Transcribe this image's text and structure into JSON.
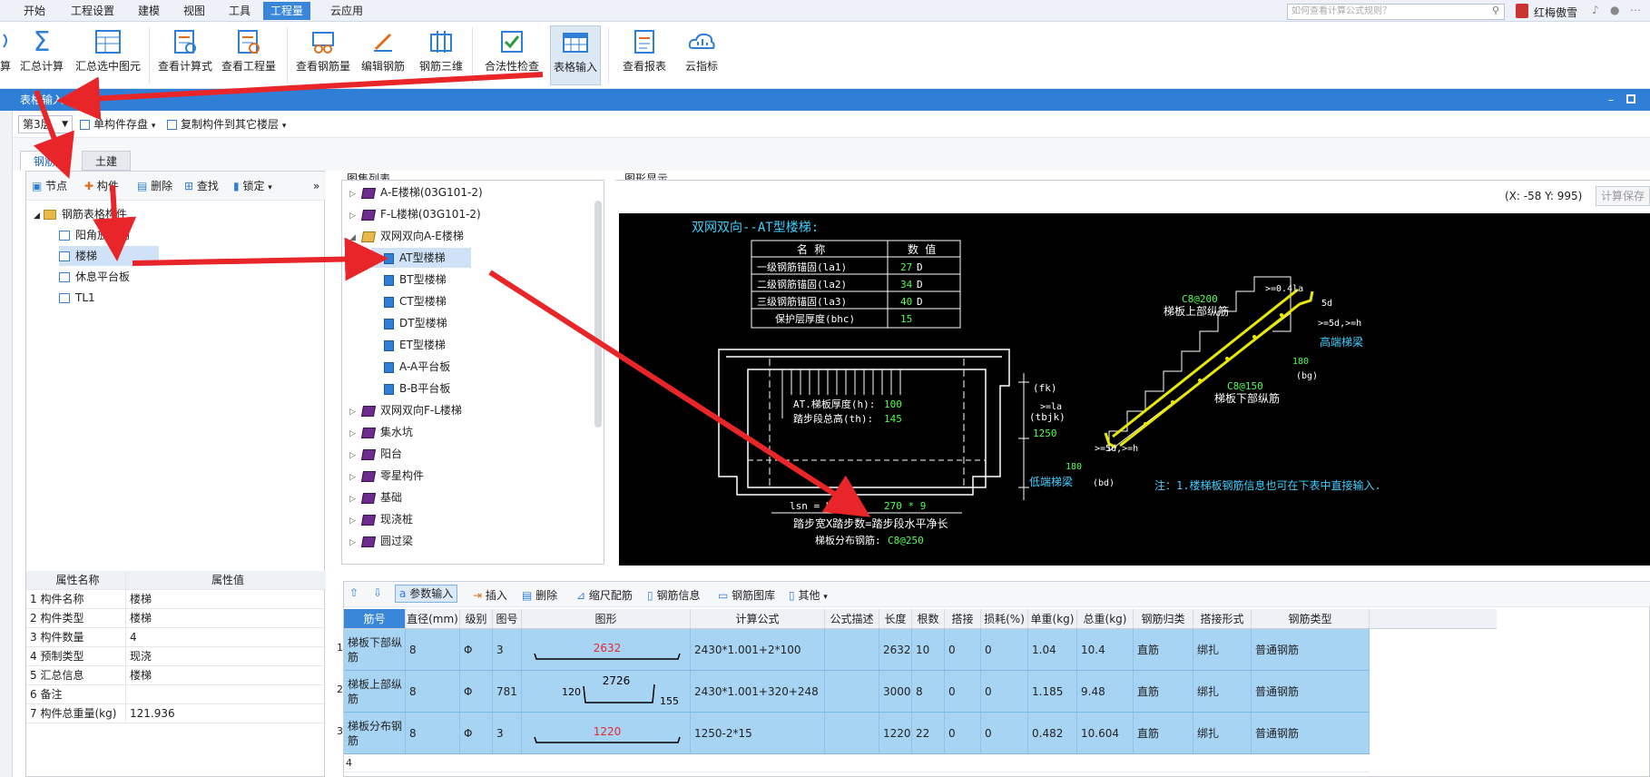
{
  "menu": {
    "items": [
      "开始",
      "工程设置",
      "建模",
      "视图",
      "工具",
      "工程量",
      "云应用"
    ],
    "active_index": 5
  },
  "search": {
    "placeholder": "如何查看计算公式规则？"
  },
  "user": {
    "name": "红梅傲雪"
  },
  "ribbon": {
    "items": [
      "汇总计算",
      "汇总选中图元",
      "查看计算式",
      "查看工程量",
      "查看钢筋量",
      "编辑钢筋",
      "钢筋三维",
      "合法性检查",
      "表格输入",
      "查看报表",
      "云指标"
    ],
    "partial_left": "算"
  },
  "window": {
    "title": "表格输入"
  },
  "toolbar2": {
    "floor": "第3层",
    "save_component": "单构件存盘",
    "copy_to_floor": "复制构件到其它楼层"
  },
  "tabs": [
    "钢筋",
    "土建"
  ],
  "left_toolbar": {
    "node": "节点",
    "component": "构件",
    "delete": "删除",
    "find": "查找",
    "lock": "锁定"
  },
  "left_tree": {
    "root": "钢筋表格构件",
    "items": [
      "阳角放射筋",
      "楼梯",
      "休息平台板",
      "TL1"
    ]
  },
  "props": {
    "header": {
      "name": "属性名称",
      "value": "属性值"
    },
    "rows": [
      {
        "name": "1 构件名称",
        "value": "楼梯"
      },
      {
        "name": "2 构件类型",
        "value": "楼梯"
      },
      {
        "name": "3 构件数量",
        "value": "4"
      },
      {
        "name": "4 预制类型",
        "value": "现浇"
      },
      {
        "name": "5 汇总信息",
        "value": "楼梯"
      },
      {
        "name": "6 备注",
        "value": ""
      },
      {
        "name": "7 构件总重量(kg)",
        "value": "121.936"
      }
    ]
  },
  "atlas": {
    "title": "图集列表",
    "items": [
      {
        "label": "A-E楼梯(03G101-2)",
        "type": "book",
        "level": 0,
        "arrow": "▷"
      },
      {
        "label": "F-L楼梯(03G101-2)",
        "type": "book",
        "level": 0,
        "arrow": "▷"
      },
      {
        "label": "双网双向A-E楼梯",
        "type": "open",
        "level": 0,
        "arrow": "◢"
      },
      {
        "label": "AT型楼梯",
        "type": "doc",
        "level": 1,
        "arrow": ""
      },
      {
        "label": "BT型楼梯",
        "type": "doc",
        "level": 1,
        "arrow": ""
      },
      {
        "label": "CT型楼梯",
        "type": "doc",
        "level": 1,
        "arrow": ""
      },
      {
        "label": "DT型楼梯",
        "type": "doc",
        "level": 1,
        "arrow": ""
      },
      {
        "label": "ET型楼梯",
        "type": "doc",
        "level": 1,
        "arrow": ""
      },
      {
        "label": "A-A平台板",
        "type": "doc",
        "level": 1,
        "arrow": ""
      },
      {
        "label": "B-B平台板",
        "type": "doc",
        "level": 1,
        "arrow": ""
      },
      {
        "label": "双网双向F-L楼梯",
        "type": "book",
        "level": 0,
        "arrow": "▷"
      },
      {
        "label": "集水坑",
        "type": "book",
        "level": 0,
        "arrow": "▷"
      },
      {
        "label": "阳台",
        "type": "book",
        "level": 0,
        "arrow": "▷"
      },
      {
        "label": "零星构件",
        "type": "book",
        "level": 0,
        "arrow": "▷"
      },
      {
        "label": "基础",
        "type": "book",
        "level": 0,
        "arrow": "▷"
      },
      {
        "label": "现浇桩",
        "type": "book",
        "level": 0,
        "arrow": "▷"
      },
      {
        "label": "圆过梁",
        "type": "book",
        "level": 0,
        "arrow": "▷"
      }
    ]
  },
  "graph": {
    "title": "图形显示",
    "coords": "(X: -58 Y: 995)",
    "calc_save": "计算保存",
    "cad": {
      "heading": "双网双向--AT型楼梯:",
      "table_head": [
        "名 称",
        "数 值"
      ],
      "table_rows": [
        [
          "一级钢筋锚固(la1)",
          "27",
          "D"
        ],
        [
          "二级钢筋锚固(la2)",
          "34",
          "D"
        ],
        [
          "三级钢筋锚固(la3)",
          "40",
          "D"
        ],
        [
          "保护层厚度(bhc)",
          "15",
          ""
        ]
      ],
      "thickness_label": "AT.梯板厚度(h):",
      "thickness_value": "100",
      "height_label": "踏步段总高(th):",
      "height_value": "145",
      "fk": "(fk)",
      "tbjk": "(tbjk)",
      "dim1250": "1250",
      "lsn_label": "lsn = bs*m =",
      "lsn_value": "270 * 9",
      "tread_note": "踏步宽X踏步数=踏步段水平净长",
      "dist_label": "梯板分布钢筋:",
      "dist_value": "C8@250",
      "top_rebar_code": "C8@200",
      "top_rebar_label": "梯板上部纵筋",
      "bottom_rebar_code": "C8@150",
      "bottom_rebar_label": "梯板下部纵筋",
      "dim_041": ">=0.4la",
      "dim_5d": "5d",
      "dim_5dh": ">=5d,>=h",
      "dim_180a": "180",
      "bg": "(bg)",
      "high_beam": "高端梯梁",
      "dim_la": ">=la",
      "dim_5dh2": ">=5d,>=h",
      "dim_180b": "180",
      "low_beam": "低端梯梁",
      "bd": "(bd)",
      "note": "注：1.楼梯板钢筋信息也可在下表中直接输入."
    }
  },
  "grid_toolbar": {
    "param_input": "参数输入",
    "insert": "插入",
    "delete": "删除",
    "scale": "缩尺配筋",
    "rebar_info": "钢筋信息",
    "rebar_lib": "钢筋图库",
    "other": "其他"
  },
  "grid": {
    "headers": [
      "筋号",
      "直径(mm)",
      "级别",
      "图号",
      "图形",
      "计算公式",
      "公式描述",
      "长度",
      "根数",
      "搭接",
      "损耗(%)",
      "单重(kg)",
      "总重(kg)",
      "钢筋归类",
      "搭接形式",
      "钢筋类型"
    ],
    "rows": [
      {
        "no": "1",
        "name": "梯板下部纵筋",
        "dia": "8",
        "grade": "Φ",
        "fig": "3",
        "shape_val": "2632",
        "formula": "2430*1.001+2*100",
        "desc": "",
        "len": "2632",
        "count": "10",
        "lap": "0",
        "loss": "0",
        "unit": "1.04",
        "total": "10.4",
        "cat": "直筋",
        "lapform": "绑扎",
        "type": "普通钢筋"
      },
      {
        "no": "2",
        "name": "梯板上部纵筋",
        "dia": "8",
        "grade": "Φ",
        "fig": "781",
        "shape_val": "2726",
        "shape_left": "120",
        "shape_right": "155",
        "formula": "2430*1.001+320+248",
        "desc": "",
        "len": "3000",
        "count": "8",
        "lap": "0",
        "loss": "0",
        "unit": "1.185",
        "total": "9.48",
        "cat": "直筋",
        "lapform": "绑扎",
        "type": "普通钢筋"
      },
      {
        "no": "3",
        "name": "梯板分布钢筋",
        "dia": "8",
        "grade": "Φ",
        "fig": "3",
        "shape_val": "1220",
        "formula": "1250-2*15",
        "desc": "",
        "len": "1220",
        "count": "22",
        "lap": "0",
        "loss": "0",
        "unit": "0.482",
        "total": "10.604",
        "cat": "直筋",
        "lapform": "绑扎",
        "type": "普通钢筋"
      }
    ],
    "empty_row_no": "4"
  }
}
